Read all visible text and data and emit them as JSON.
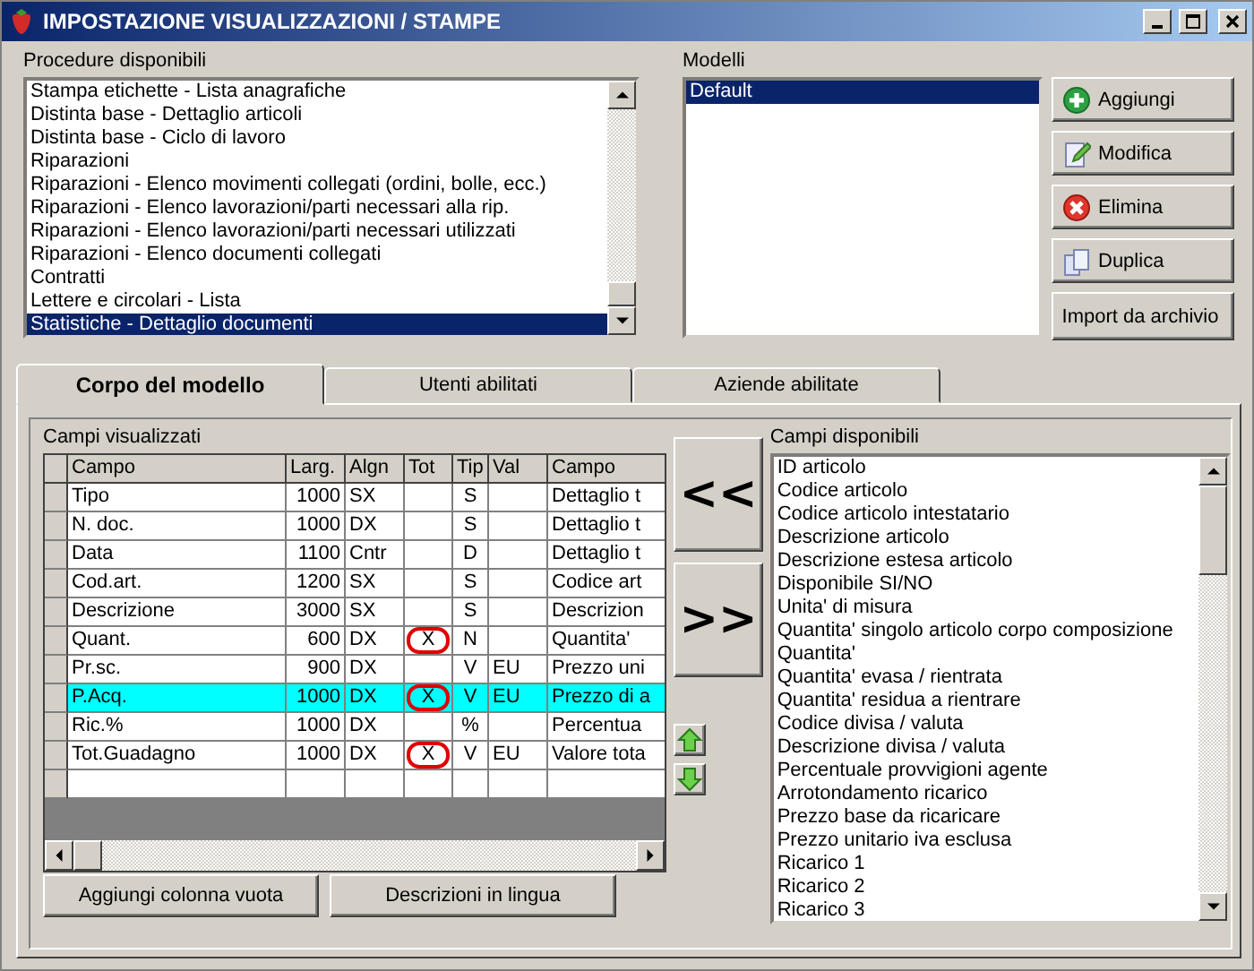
{
  "window": {
    "title": "IMPOSTAZIONE VISUALIZZAZIONI / STAMPE"
  },
  "procedures": {
    "label": "Procedure disponibili",
    "items": [
      {
        "label": "Stampa etichette - Lista anagrafiche",
        "selected": false
      },
      {
        "label": "Distinta base - Dettaglio articoli",
        "selected": false
      },
      {
        "label": "Distinta base - Ciclo di lavoro",
        "selected": false
      },
      {
        "label": "Riparazioni",
        "selected": false
      },
      {
        "label": "Riparazioni - Elenco movimenti collegati (ordini, bolle, ecc.)",
        "selected": false
      },
      {
        "label": "Riparazioni - Elenco lavorazioni/parti necessari alla rip.",
        "selected": false
      },
      {
        "label": "Riparazioni - Elenco lavorazioni/parti necessari utilizzati",
        "selected": false
      },
      {
        "label": "Riparazioni - Elenco documenti collegati",
        "selected": false
      },
      {
        "label": "Contratti",
        "selected": false
      },
      {
        "label": "Lettere e circolari - Lista",
        "selected": false
      },
      {
        "label": "Statistiche - Dettaglio documenti",
        "selected": true
      }
    ]
  },
  "models": {
    "label": "Modelli",
    "items": [
      {
        "label": "Default",
        "selected": true
      }
    ]
  },
  "model_buttons": [
    {
      "label": "Aggiungi",
      "kind": "add"
    },
    {
      "label": "Modifica",
      "kind": "edit"
    },
    {
      "label": "Elimina",
      "kind": "delete"
    },
    {
      "label": "Duplica",
      "kind": "duplicate"
    },
    {
      "label": "Import da archivio",
      "kind": "plain"
    }
  ],
  "tabs": [
    {
      "label": "Corpo del modello",
      "selected": true
    },
    {
      "label": "Utenti abilitati",
      "selected": false
    },
    {
      "label": "Aziende abilitate",
      "selected": false
    }
  ],
  "fields_table": {
    "label": "Campi visualizzati",
    "columns": [
      "Campo",
      "Larg.",
      "Algn",
      "Tot",
      "Tip",
      "Val",
      "Campo"
    ],
    "rows": [
      {
        "campo": "Tipo",
        "larg": "1000",
        "algn": "SX",
        "tip": "S",
        "campo_2": "Dettaglio t",
        "selected": false,
        "circled": false
      },
      {
        "campo": "N. doc.",
        "larg": "1000",
        "algn": "DX",
        "tip": "S",
        "campo_2": "Dettaglio t",
        "selected": false,
        "circled": false
      },
      {
        "campo": "Data",
        "larg": "1100",
        "algn": "Cntr",
        "tip": "D",
        "campo_2": "Dettaglio t",
        "selected": false,
        "circled": false
      },
      {
        "campo": "Cod.art.",
        "larg": "1200",
        "algn": "SX",
        "tip": "S",
        "campo_2": "Codice art",
        "selected": false,
        "circled": false
      },
      {
        "campo": "Descrizione",
        "larg": "3000",
        "algn": "SX",
        "tip": "S",
        "campo_2": "Descrizion",
        "selected": false,
        "circled": false
      },
      {
        "campo": "Quant.",
        "larg": "600",
        "algn": "DX",
        "tot": "X",
        "tip": "N",
        "campo_2": "Quantita'",
        "selected": false,
        "circled": true
      },
      {
        "campo": "Pr.sc.",
        "larg": "900",
        "algn": "DX",
        "tip": "V",
        "val": "EU",
        "campo_2": "Prezzo uni",
        "selected": false,
        "circled": false
      },
      {
        "campo": "P.Acq.",
        "larg": "1000",
        "algn": "DX",
        "tot": "X",
        "tip": "V",
        "val": "EU",
        "campo_2": "Prezzo di a",
        "selected": true,
        "circled": true
      },
      {
        "campo": "Ric.%",
        "larg": "1000",
        "algn": "DX",
        "tip": "%",
        "campo_2": "Percentua",
        "selected": false,
        "circled": false
      },
      {
        "campo": "Tot.Guadagno",
        "larg": "1000",
        "algn": "DX",
        "tot": "X",
        "tip": "V",
        "val": "EU",
        "campo_2": "Valore tota",
        "selected": false,
        "circled": true
      }
    ]
  },
  "move_buttons": [
    "<<",
    ">>"
  ],
  "available_fields": {
    "label": "Campi disponibili",
    "items": [
      "ID articolo",
      "Codice articolo",
      "Codice articolo intestatario",
      "Descrizione articolo",
      "Descrizione estesa articolo",
      "Disponibile SI/NO",
      "Unita' di misura",
      "Quantita' singolo articolo corpo composizione",
      "Quantita'",
      "Quantita' evasa / rientrata",
      "Quantita' residua a rientrare",
      "Codice divisa / valuta",
      "Descrizione divisa / valuta",
      "Percentuale provvigioni agente",
      "Arrotondamento ricarico",
      "Prezzo base da ricaricare",
      "Prezzo unitario iva esclusa",
      "Ricarico 1",
      "Ricarico 2",
      "Ricarico 3"
    ]
  },
  "bottom_buttons": [
    "Aggiungi colonna vuota",
    "Descrizioni in lingua"
  ]
}
